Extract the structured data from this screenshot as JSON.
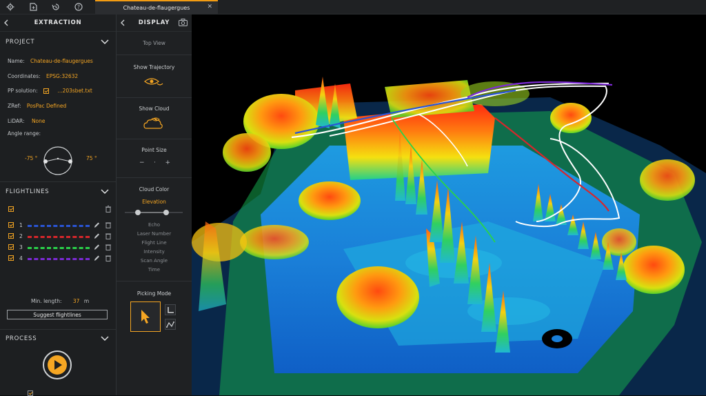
{
  "tab": {
    "title": "Chateau-de-flaugergues",
    "close": "✕"
  },
  "extraction": {
    "title": "EXTRACTION",
    "project": {
      "heading": "PROJECT",
      "name_label": "Name:",
      "name_value": "Chateau-de-flaugergues",
      "coords_label": "Coordinates:",
      "coords_value": "EPSG:32632",
      "pp_label": "PP solution:",
      "pp_value": "...203sbet.txt",
      "zref_label": "ZRef:",
      "zref_value": "PosPac Defined",
      "lidar_label": "LiDAR:",
      "lidar_value": "None",
      "angle_label": "Angle range:",
      "angle_min": "-75 °",
      "angle_max": "75 °"
    },
    "flightlines": {
      "heading": "FLIGHTLINES",
      "lines": [
        {
          "num": "1",
          "color": "#2a55d6"
        },
        {
          "num": "2",
          "color": "#d8262b"
        },
        {
          "num": "3",
          "color": "#2ad24a"
        },
        {
          "num": "4",
          "color": "#7d2ad6"
        }
      ],
      "min_length_label": "Min. length:",
      "min_length_value": "37",
      "min_length_unit": "m",
      "suggest_button": "Suggest flightlines"
    },
    "process": {
      "heading": "PROCESS"
    }
  },
  "display": {
    "title": "DISPLAY",
    "top_view": "Top View",
    "show_trajectory": "Show Trajectory",
    "show_cloud": "Show Cloud",
    "point_size": "Point Size",
    "point_size_minus": "−",
    "point_size_dot": "·",
    "point_size_plus": "+",
    "cloud_color": "Cloud Color",
    "cloud_color_selected": "Elevation",
    "cloud_color_options": [
      "Echo",
      "Laser Number",
      "Flight Line",
      "Intensity",
      "Scan Angle",
      "Time"
    ],
    "picking_mode": "Picking Mode"
  },
  "colors": {
    "accent": "#f5a623",
    "panel": "#1d1f21",
    "viewport": "#000000"
  },
  "icons": [
    "gear-icon",
    "new-document-icon",
    "history-icon",
    "help-icon",
    "chevron-left-icon",
    "camera-icon",
    "eye-trajectory-icon",
    "eye-cloud-icon",
    "pencil-icon",
    "trash-icon",
    "play-icon",
    "cursor-icon",
    "measure-angle-icon",
    "measure-path-icon"
  ]
}
